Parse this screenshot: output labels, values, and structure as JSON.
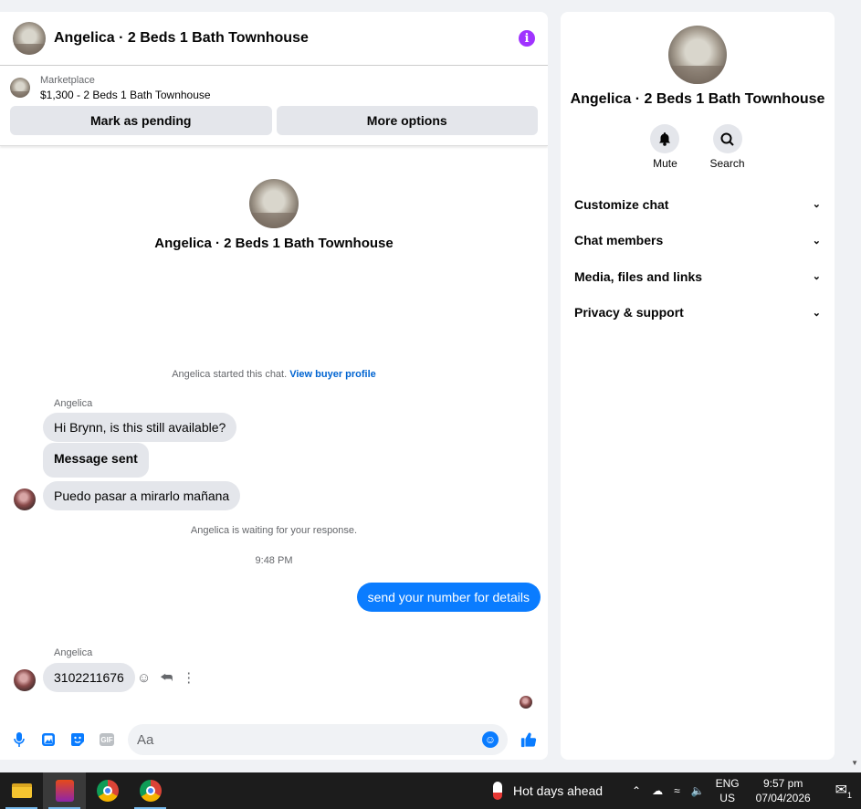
{
  "chat": {
    "title": "Angelica · 2 Beds 1 Bath Townhouse",
    "info_icon": "i",
    "marketplace": {
      "label": "Marketplace",
      "item": "$1,300 - 2 Beds 1 Bath Townhouse",
      "mark_pending": "Mark as pending",
      "more_options": "More options"
    },
    "intro_title": "Angelica · 2 Beds 1 Bath Townhouse",
    "started_text": "Angelica started this chat.",
    "view_profile": "View buyer profile",
    "sender_name": "Angelica",
    "messages": [
      "Hi Brynn, is this still available?",
      "Message sent",
      "Puedo pasar a mirarlo mañana"
    ],
    "waiting_text": "Angelica is waiting for your response.",
    "timestamp": "9:48 PM",
    "outgoing": "send your number for details",
    "sender_name_2": "Angelica",
    "reply": "3102211676",
    "composer": {
      "placeholder": "Aa",
      "gif_label": "GIF"
    }
  },
  "info": {
    "title": "Angelica · 2 Beds 1 Bath Townhouse",
    "mute": "Mute",
    "search": "Search",
    "sections": [
      "Customize chat",
      "Chat members",
      "Media, files and links",
      "Privacy & support"
    ]
  },
  "taskbar": {
    "weather": "Hot days ahead",
    "lang_top": "ENG",
    "lang_bottom": "US",
    "time": "9:57 pm",
    "date": "07/04/2026",
    "notif_count": "1"
  },
  "colors": {
    "accent": "#0a7cff",
    "info_purple": "#a033ff",
    "bubble_gray": "#e4e6eb"
  }
}
